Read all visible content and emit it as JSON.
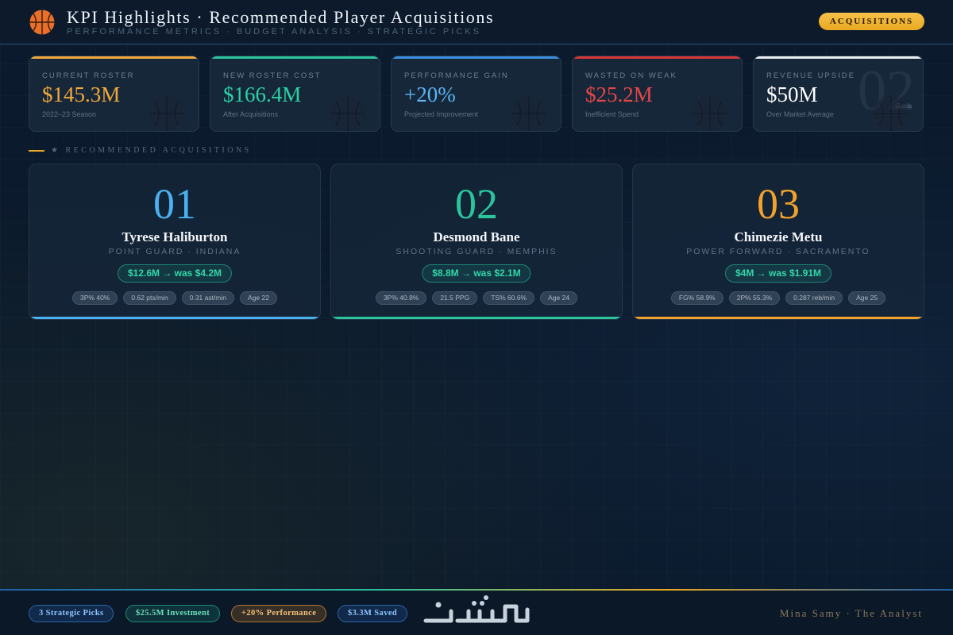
{
  "header": {
    "title": "KPI Highlights · Recommended Player Acquisitions",
    "subtitle": "PERFORMANCE METRICS · BUDGET ANALYSIS · STRATEGIC PICKS",
    "tag_label": "ACQUISITIONS",
    "logo_icon": "basketball-icon"
  },
  "kpis": [
    {
      "label": "CURRENT ROSTER",
      "value": "$145.3M",
      "note": "2022–23 Season",
      "color": "#f2a93b",
      "value_color": "#f2a93b"
    },
    {
      "label": "NEW ROSTER COST",
      "value": "$166.4M",
      "note": "After Acquisitions",
      "color": "#2bc59b",
      "value_color": "#2bd2a4"
    },
    {
      "label": "PERFORMANCE GAIN",
      "value": "+20%",
      "note": "Projected Improvement",
      "color": "#3d8fe0",
      "value_color": "#5ab4f5"
    },
    {
      "label": "WASTED ON WEAK",
      "value": "$25.2M",
      "note": "Inefficient Spend",
      "color": "#d93636",
      "value_color": "#e64646"
    },
    {
      "label": "REVENUE UPSIDE",
      "value": "$50M",
      "note": "Over Market Average",
      "color": "#e8edf2",
      "value_color": "#ffffff",
      "ghost": "02",
      "ghost_note": "Goals"
    }
  ],
  "section": {
    "title": "★ RECOMMENDED ACQUISITIONS"
  },
  "players": [
    {
      "rank": "01",
      "name": "Tyrese Haliburton",
      "role": "POINT GUARD · INDIANA",
      "price": "$12.6M → was $4.2M",
      "color": "#4ab0f0",
      "stats": [
        "3P% 40%",
        "0.62 pts/min",
        "0.31 ast/min",
        "Age 22"
      ]
    },
    {
      "rank": "02",
      "name": "Desmond Bane",
      "role": "SHOOTING GUARD · MEMPHIS",
      "price": "$8.8M → was $2.1M",
      "color": "#2bc59b",
      "stats": [
        "3P% 40.8%",
        "21.5 PPG",
        "TS% 60.6%",
        "Age 24"
      ]
    },
    {
      "rank": "03",
      "name": "Chimezie Metu",
      "role": "POWER FORWARD · SACRAMENTO",
      "price": "$4M → was $1.91M",
      "color": "#f2a22b",
      "stats": [
        "FG% 58.9%",
        "2P% 55.3%",
        "0.287 reb/min",
        "Age 25"
      ]
    }
  ],
  "footer": {
    "pills": [
      {
        "label": "3 Strategic Picks",
        "style": "blue"
      },
      {
        "label": "$25.5M Investment",
        "style": "green"
      },
      {
        "label": "+20% Performance",
        "style": "orange"
      },
      {
        "label": "$3.3M Saved",
        "style": "blue"
      }
    ],
    "brand_text": "خمسات",
    "signature": "Mina Samy · The Analyst"
  }
}
